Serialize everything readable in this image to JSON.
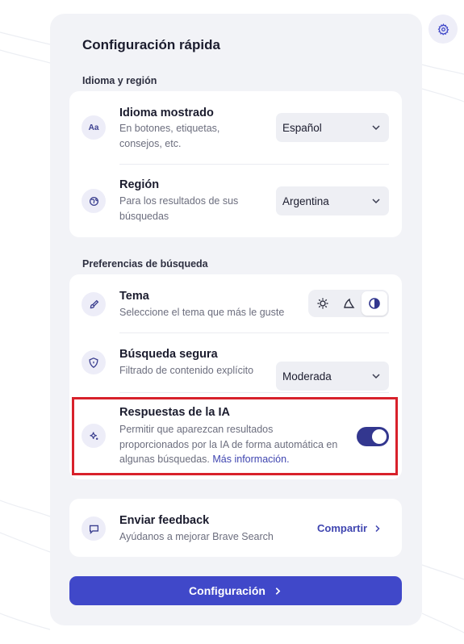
{
  "panel": {
    "title": "Configuración rápida"
  },
  "settings_icon": "gear-icon",
  "sections": {
    "language": {
      "label": "Idioma y región",
      "language_row": {
        "icon": "translate-icon",
        "icon_text": "Aa",
        "title": "Idioma mostrado",
        "desc_line1": "En botones, etiquetas,",
        "desc_line2": "consejos, etc.",
        "value": "Español"
      },
      "region_row": {
        "icon": "globe-icon",
        "title": "Región",
        "desc_line1": "Para los resultados de sus",
        "desc_line2": "búsquedas",
        "value": "Argentina"
      }
    },
    "search": {
      "label": "Preferencias de búsqueda",
      "theme_row": {
        "icon": "brush-icon",
        "title": "Tema",
        "desc": "Seleccione el tema que más le guste",
        "options": [
          "light-theme-icon",
          "dark-theme-icon",
          "system-theme-icon"
        ],
        "selected": "system-theme-icon"
      },
      "safe_row": {
        "icon": "shield-icon",
        "title": "Búsqueda segura",
        "desc": "Filtrado de contenido explícito",
        "value": "Moderada"
      },
      "ai_row": {
        "icon": "sparkle-icon",
        "title": "Respuestas de la IA",
        "desc_line1": "Permitir que aparezcan resultados",
        "desc_line2": "proporcionados por la IA de forma automática en",
        "desc_line3": "algunas búsquedas.",
        "link": "Más información.",
        "enabled": true
      }
    },
    "feedback": {
      "icon": "chat-bubble-icon",
      "title": "Enviar feedback",
      "desc": "Ayúdanos a mejorar Brave Search",
      "action": "Compartir"
    }
  },
  "main_button": {
    "label": "Configuración"
  },
  "colors": {
    "accent": "#4048c9",
    "toggle_on": "#33378f",
    "link": "#3f45b0",
    "highlight": "#d8212b",
    "panel_bg": "#f2f3f7"
  }
}
